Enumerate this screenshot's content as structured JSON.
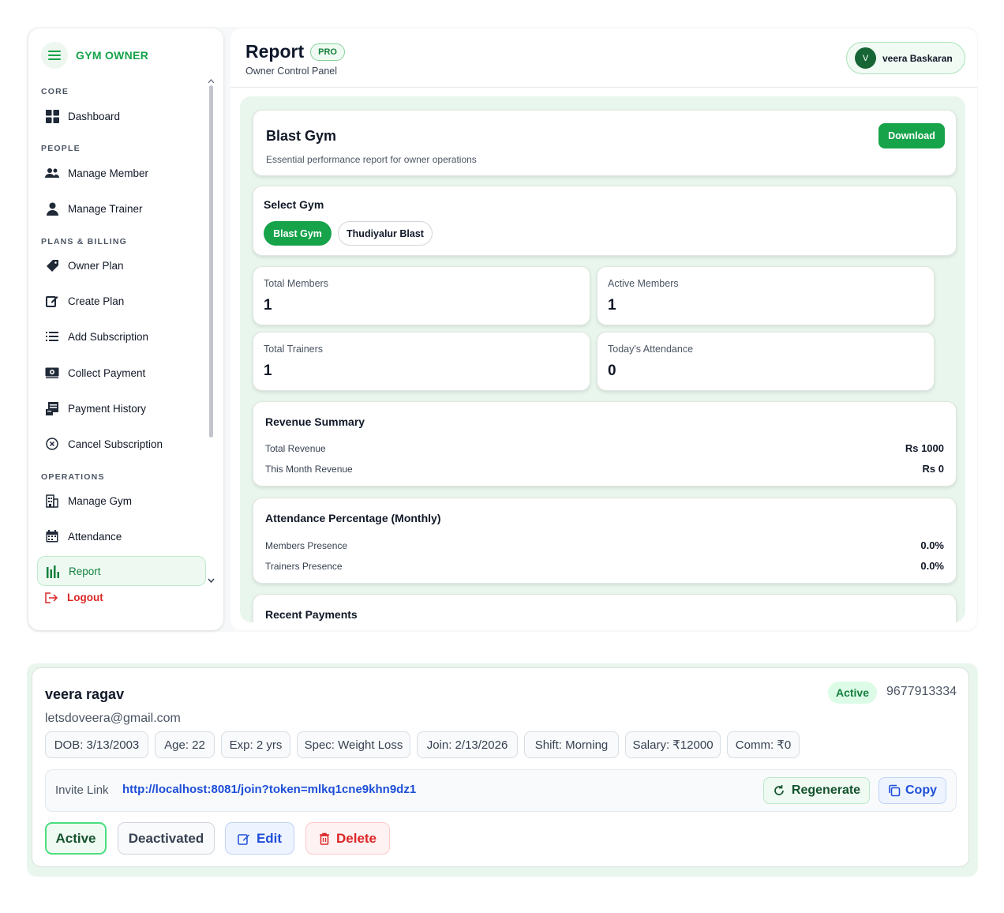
{
  "sidebar": {
    "brand": "GYM OWNER",
    "sections": {
      "core": "CORE",
      "people": "PEOPLE",
      "plans": "PLANS & BILLING",
      "operations": "OPERATIONS"
    },
    "items": [
      {
        "label": "Dashboard",
        "icon": "grid-icon"
      },
      {
        "label": "Manage Member",
        "icon": "users-icon"
      },
      {
        "label": "Manage Trainer",
        "icon": "user-icon"
      },
      {
        "label": "Owner Plan",
        "icon": "tag-icon"
      },
      {
        "label": "Create Plan",
        "icon": "edit-icon"
      },
      {
        "label": "Add Subscription",
        "icon": "list-icon"
      },
      {
        "label": "Collect Payment",
        "icon": "money-icon"
      },
      {
        "label": "Payment History",
        "icon": "receipt-icon"
      },
      {
        "label": "Cancel Subscription",
        "icon": "cancel-circle-icon"
      },
      {
        "label": "Manage Gym",
        "icon": "building-icon"
      },
      {
        "label": "Attendance",
        "icon": "calendar-icon"
      },
      {
        "label": "Report",
        "icon": "bar-chart-icon",
        "active": true
      }
    ],
    "logout": "Logout"
  },
  "header": {
    "title": "Report",
    "badge": "PRO",
    "subtitle": "Owner Control Panel",
    "user": {
      "initial": "V",
      "name": "veera Baskaran"
    }
  },
  "report": {
    "gym_name": "Blast Gym",
    "description": "Essential performance report for owner operations",
    "download_label": "Download",
    "select_gym_title": "Select Gym",
    "gyms": [
      {
        "label": "Blast Gym",
        "selected": true
      },
      {
        "label": "Thudiyalur Blast",
        "selected": false
      }
    ],
    "stats": [
      {
        "label": "Total Members",
        "value": "1"
      },
      {
        "label": "Active Members",
        "value": "1"
      },
      {
        "label": "Total Trainers",
        "value": "1"
      },
      {
        "label": "Today's Attendance",
        "value": "0"
      }
    ],
    "revenue": {
      "title": "Revenue Summary",
      "rows": [
        {
          "label": "Total Revenue",
          "value": "Rs 1000"
        },
        {
          "label": "This Month Revenue",
          "value": "Rs 0"
        }
      ]
    },
    "attendance": {
      "title": "Attendance Percentage (Monthly)",
      "rows": [
        {
          "label": "Members Presence",
          "value": "0.0%"
        },
        {
          "label": "Trainers Presence",
          "value": "0.0%"
        }
      ]
    },
    "recent_payments_title": "Recent Payments"
  },
  "member": {
    "name": "veera ragav",
    "email": "letsdoveera@gmail.com",
    "status": "Active",
    "phone": "9677913334",
    "tags": [
      "DOB: 3/13/2003",
      "Age: 22",
      "Exp: 2 yrs",
      "Spec: Weight Loss",
      "Join: 2/13/2026",
      "Shift: Morning",
      "Salary: ₹12000",
      "Comm: ₹0"
    ],
    "invite_label": "Invite Link",
    "invite_link": "http://localhost:8081/join?token=mlkq1cne9khn9dz1",
    "regenerate_label": "Regenerate",
    "copy_label": "Copy",
    "actions": {
      "active": "Active",
      "deactivated": "Deactivated",
      "edit": "Edit",
      "delete": "Delete"
    }
  },
  "colors": {
    "accent": "#16a34a",
    "danger": "#dc2626",
    "link": "#1d4ed8",
    "panel_bg": "#e9f6ed"
  }
}
